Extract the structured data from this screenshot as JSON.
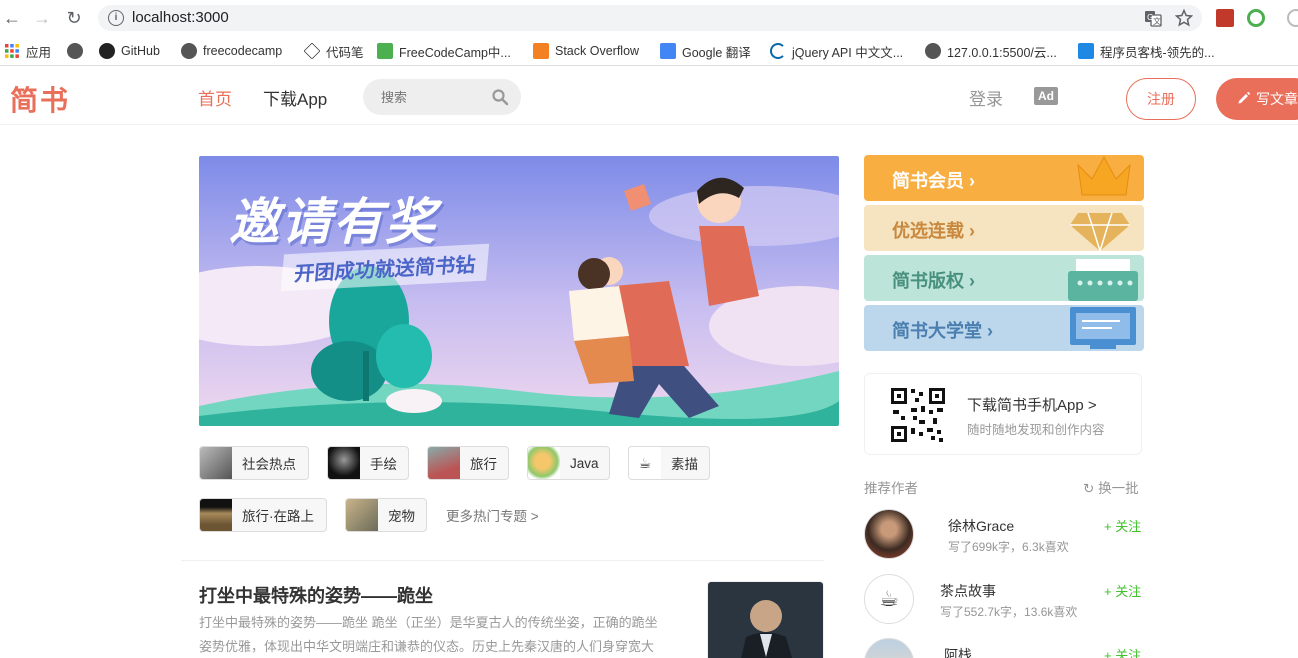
{
  "browser": {
    "url": "localhost:3000",
    "bookmarks": [
      {
        "label": "应用",
        "icon": "apps-grid-icon"
      },
      {
        "label": "GitHub",
        "icon": "github-icon"
      },
      {
        "label": "freecodecamp",
        "icon": "globe-icon"
      },
      {
        "label": "代码笔",
        "icon": "codepen-icon"
      },
      {
        "label": "FreeCodeCamp中...",
        "icon": "freecodecamp-icon"
      },
      {
        "label": "Stack Overflow",
        "icon": "stackoverflow-icon"
      },
      {
        "label": "Google 翻译",
        "icon": "google-translate-icon"
      },
      {
        "label": "jQuery API 中文文...",
        "icon": "jquery-icon"
      },
      {
        "label": "127.0.0.1:5500/云...",
        "icon": "globe-icon"
      },
      {
        "label": "程序员客栈-领先的...",
        "icon": "proginn-icon"
      }
    ]
  },
  "header": {
    "logo": "简书",
    "nav_home": "首页",
    "nav_app": "下载App",
    "search_placeholder": "搜索",
    "login": "登录",
    "ad": "Ad",
    "register": "注册",
    "write": "写文章"
  },
  "banner": {
    "title": "邀请有奖",
    "subtitle": "开团成功就送简书钻"
  },
  "topics": [
    {
      "label": "社会热点"
    },
    {
      "label": "手绘"
    },
    {
      "label": "旅行"
    },
    {
      "label": "Java"
    },
    {
      "label": "素描"
    },
    {
      "label": "旅行·在路上"
    },
    {
      "label": "宠物"
    }
  ],
  "more_topics": "更多热门专题 >",
  "article": {
    "title": "打坐中最特殊的姿势——跪坐",
    "abstract": "打坐中最特殊的姿势——跪坐 跪坐（正坐）是华夏古人的传统坐姿，正确的跪坐姿势优雅，体现出中华文明端庄和谦恭的仪态。历史上先秦汉唐的人们身穿宽大飘..."
  },
  "boards": [
    {
      "label": "简书会员",
      "color": "#f9ae41",
      "text_color": "#ffffff"
    },
    {
      "label": "优选连载",
      "color": "#f6e3c0",
      "text_color": "#c8883e"
    },
    {
      "label": "简书版权",
      "color": "#bde4d9",
      "text_color": "#49917d"
    },
    {
      "label": "简书大学堂",
      "color": "#bcd6ec",
      "text_color": "#4a7fb0"
    }
  ],
  "download": {
    "title": "下载简书手机App >",
    "subtitle": "随时随地发现和创作内容"
  },
  "recommend": {
    "heading": "推荐作者",
    "refresh": "换一批",
    "authors": [
      {
        "name": "徐林Grace",
        "meta": "写了699k字，6.3k喜欢",
        "follow": "+ 关注"
      },
      {
        "name": "茶点故事",
        "meta": "写了552.7k字，13.6k喜欢",
        "follow": "+ 关注"
      },
      {
        "name": "阿栈",
        "meta": "",
        "follow": "+ 关注"
      }
    ]
  },
  "colors": {
    "brand": "#ea6f5a",
    "follow_green": "#42c02e"
  }
}
